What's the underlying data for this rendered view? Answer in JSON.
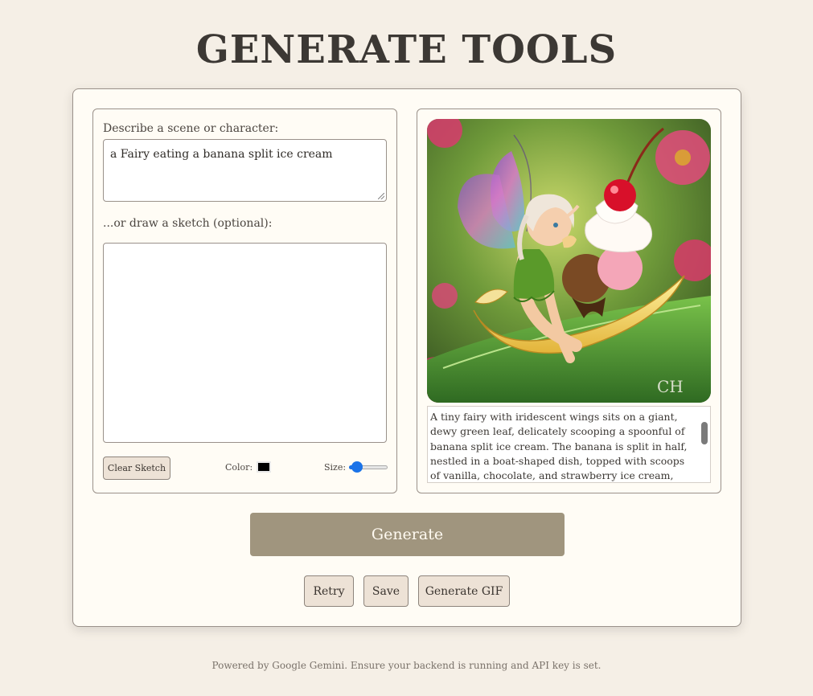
{
  "page": {
    "title": "GENERATE TOOLS"
  },
  "input": {
    "prompt_label": "Describe a scene or character:",
    "prompt_value": "a Fairy eating a banana split ice cream",
    "sketch_label": "...or draw a sketch (optional):",
    "clear_label": "Clear Sketch",
    "color_label": "Color:",
    "color_value": "#000000",
    "size_label": "Size:",
    "size_level": 0.1
  },
  "output": {
    "image_icon": "fairy-banana-split-image",
    "description": "A tiny fairy with iridescent wings sits on a giant, dewy green leaf, delicately scooping a spoonful of banana split ice cream. The banana is split in half, nestled in a boat-shaped dish, topped with scoops of vanilla, chocolate, and strawberry ice cream, drizzled with"
  },
  "actions": {
    "generate_label": "Generate",
    "retry_label": "Retry",
    "save_label": "Save",
    "gif_label": "Generate GIF"
  },
  "footer": {
    "text": "Powered by Google Gemini. Ensure your backend is running and API key is set."
  },
  "colors": {
    "background": "#f5efe6",
    "card": "#fffcf5",
    "accent": "#a0957e",
    "button": "#ede2d6"
  }
}
